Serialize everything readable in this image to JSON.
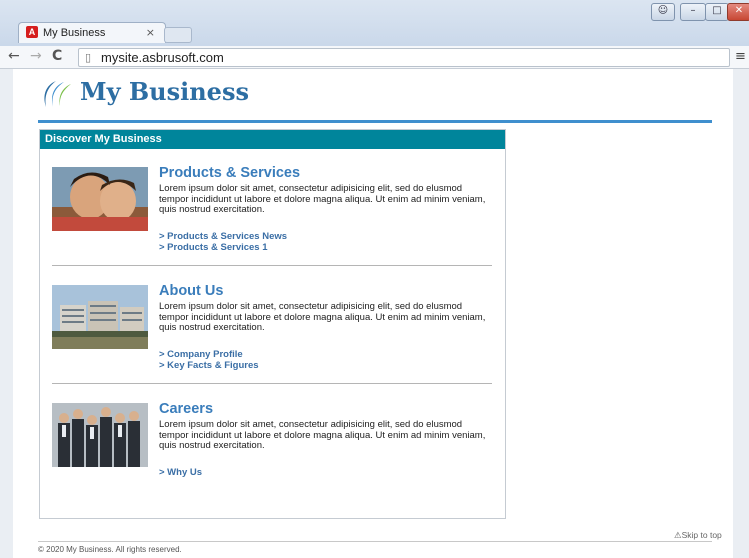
{
  "browser": {
    "tab_title": "My Business",
    "tab_close": "×",
    "url": "mysite.asbrusoft.com",
    "favicon_letter": "A",
    "nav_icons": [
      "back-arrow-icon",
      "forward-arrow-icon",
      "reload-icon",
      "page-icon",
      "menu-icon"
    ]
  },
  "site": {
    "title": "My Business",
    "brand_colors": {
      "primary": "#2d6ea3",
      "accent": "#00859b",
      "rule": "#3f8fce"
    }
  },
  "discover": {
    "heading": "Discover My Business",
    "items": [
      {
        "title": "Products & Services",
        "desc": "Lorem ipsum dolor sit amet, consectetur adipisicing elit, sed do elusmod tempor incididunt ut labore et dolore magna aliqua. Ut enim ad minim veniam, quis nostrud exercitation.",
        "links": [
          "> Products & Services News",
          "> Products & Services 1"
        ]
      },
      {
        "title": "About Us",
        "desc": "Lorem ipsum dolor sit amet, consectetur adipisicing elit, sed do elusmod tempor incididunt ut labore et dolore magna aliqua. Ut enim ad minim veniam, quis nostrud exercitation.",
        "links": [
          "> Company Profile",
          "> Key Facts & Figures"
        ]
      },
      {
        "title": "Careers",
        "desc": "Lorem ipsum dolor sit amet, consectetur adipisicing elit, sed do elusmod tempor incididunt ut labore et dolore magna aliqua. Ut enim ad minim veniam, quis nostrud exercitation.",
        "links": [
          "> Why Us"
        ]
      }
    ]
  },
  "footer": {
    "skip_to_top": "Skip to top",
    "copyright": "© 2020 My Business. All rights reserved."
  }
}
